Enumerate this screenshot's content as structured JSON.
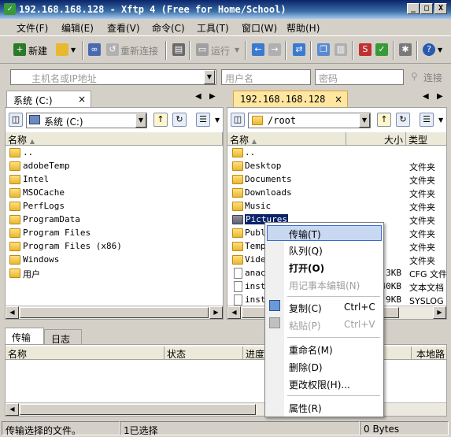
{
  "window": {
    "title": "192.168.168.128 - Xftp 4 (Free for Home/School)",
    "min": "_",
    "max": "□",
    "close": "X"
  },
  "menu": [
    "文件(F)",
    "编辑(E)",
    "查看(V)",
    "命令(C)",
    "工具(T)",
    "窗口(W)",
    "帮助(H)"
  ],
  "toolbar": {
    "new": "新建",
    "reconnect": "重新连接",
    "run": "运行"
  },
  "address": {
    "host_placeholder": "主机名或IP地址",
    "user_placeholder": "用户名",
    "password_placeholder": "密码",
    "connect": "连接"
  },
  "left": {
    "tab": "系统 (C:)",
    "tab_close": "×",
    "drive": "系统 (C:)",
    "col_name": "名称",
    "rows": [
      "..",
      "adobeTemp",
      "Intel",
      "MSOCache",
      "PerfLogs",
      "ProgramData",
      "Program Files",
      "Program Files (x86)",
      "Windows",
      "用户"
    ]
  },
  "right": {
    "tab": "192.168.168.128",
    "tab_close": "×",
    "path": "/root",
    "cols": {
      "name": "名称",
      "size": "大小",
      "type": "类型"
    },
    "rows": [
      {
        "name": "..",
        "size": "",
        "type": "",
        "kind": "folder"
      },
      {
        "name": "Desktop",
        "size": "",
        "type": "文件夹",
        "kind": "folder"
      },
      {
        "name": "Documents",
        "size": "",
        "type": "文件夹",
        "kind": "folder"
      },
      {
        "name": "Downloads",
        "size": "",
        "type": "文件夹",
        "kind": "folder"
      },
      {
        "name": "Music",
        "size": "",
        "type": "文件夹",
        "kind": "folder"
      },
      {
        "name": "Pictures",
        "size": "",
        "type": "文件夹",
        "kind": "folder",
        "selected": true
      },
      {
        "name": "Publ",
        "size": "",
        "type": "文件夹",
        "kind": "folder"
      },
      {
        "name": "Temp",
        "size": "",
        "type": "文件夹",
        "kind": "folder"
      },
      {
        "name": "Vide",
        "size": "",
        "type": "文件夹",
        "kind": "folder"
      },
      {
        "name": "anac",
        "size": "3KB",
        "type": "CFG 文件",
        "kind": "file"
      },
      {
        "name": "inst",
        "size": "40KB",
        "type": "文本文档",
        "kind": "file"
      },
      {
        "name": "inst",
        "size": "9KB",
        "type": "SYSLOG 文",
        "kind": "file"
      }
    ]
  },
  "bottom": {
    "tabs": [
      "传输",
      "日志"
    ],
    "cols": [
      "名称",
      "状态",
      "进度",
      "本地路"
    ]
  },
  "context_menu": [
    {
      "label": "传输(T)",
      "highlighted": true
    },
    {
      "label": "队列(Q)"
    },
    {
      "label": "打开(O)",
      "bold": true
    },
    {
      "label": "用记事本编辑(N)",
      "disabled": true
    },
    {
      "label": "复制(C)",
      "shortcut": "Ctrl+C"
    },
    {
      "label": "粘贴(P)",
      "shortcut": "Ctrl+V",
      "disabled": true
    },
    {
      "label": "重命名(M)"
    },
    {
      "label": "删除(D)"
    },
    {
      "label": "更改权限(H)..."
    },
    {
      "label": "属性(R)"
    }
  ],
  "status": {
    "left": "传输选择的文件。",
    "mid": "1已选择",
    "right": "0 Bytes"
  }
}
